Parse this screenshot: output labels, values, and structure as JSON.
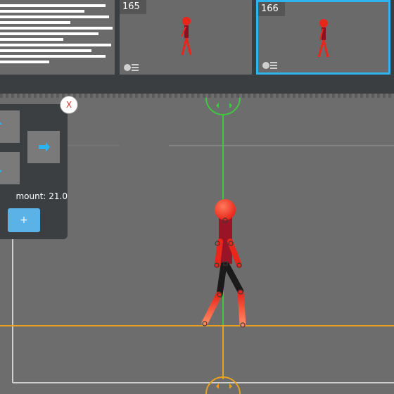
{
  "timeline": {
    "frames": [
      {
        "number": "165",
        "selected": false
      },
      {
        "number": "166",
        "selected": true
      }
    ]
  },
  "panel": {
    "close_label": "X",
    "amount_label": "mount: 21.0",
    "add_label": "+"
  },
  "colors": {
    "selected_frame_border": "#2db3ee",
    "green_axis": "#3ec93e",
    "orange_axis": "#e9a21e",
    "figure_red": "#e8261a",
    "add_button": "#5ab2e6"
  }
}
